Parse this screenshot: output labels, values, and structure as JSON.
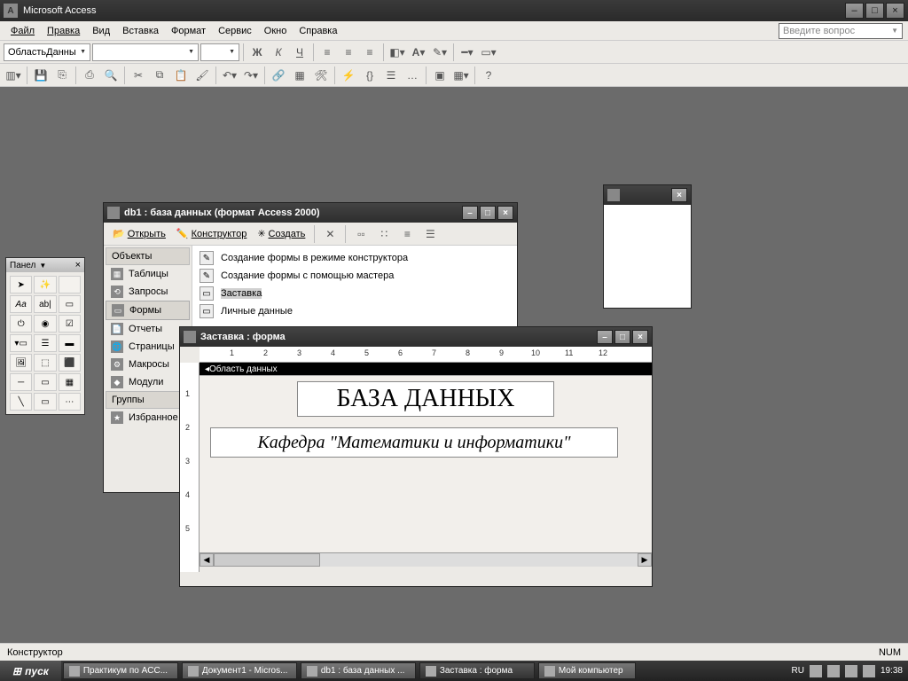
{
  "app": {
    "title": "Microsoft Access"
  },
  "menu": [
    "Файл",
    "Правка",
    "Вид",
    "Вставка",
    "Формат",
    "Сервис",
    "Окно",
    "Справка"
  ],
  "askbox": {
    "placeholder": "Введите вопрос"
  },
  "fmt_toolbar": {
    "object_selector": "ОбластьДанны"
  },
  "toolbox": {
    "title": "Панел"
  },
  "dbwin": {
    "title": "db1 : база данных (формат Access 2000)",
    "buttons": {
      "open": "Открыть",
      "design": "Конструктор",
      "new": "Создать"
    },
    "groups_header": "Объекты",
    "nav": [
      "Таблицы",
      "Запросы",
      "Формы",
      "Отчеты",
      "Страницы",
      "Макросы",
      "Модули"
    ],
    "groups2": "Группы",
    "fav": "Избранное",
    "list": [
      "Создание формы в режиме конструктора",
      "Создание формы с помощью мастера",
      "Заставка",
      "Личные данные"
    ]
  },
  "formwin": {
    "title": "Заставка : форма",
    "section": "Область данных",
    "label1": "БАЗА ДАННЫХ",
    "label2": "Кафедра \"Математики и информатики\""
  },
  "status": {
    "left": "Конструктор",
    "right": "NUM"
  },
  "taskbar": {
    "start": "пуск",
    "tasks": [
      "Практикум по ACC...",
      "Документ1 - Micros...",
      "db1 : база данных ...",
      "Заставка : форма",
      "Мой компьютер"
    ],
    "lang": "RU",
    "clock": "19:38"
  }
}
